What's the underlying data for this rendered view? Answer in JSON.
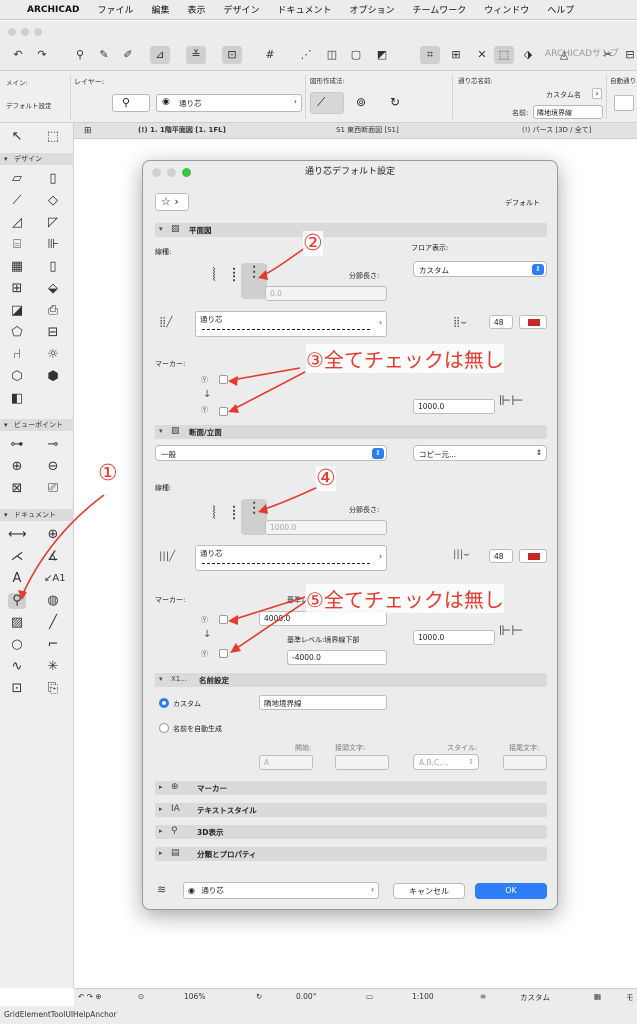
{
  "menubar": {
    "apple": "",
    "items": [
      "ARCHICAD",
      "ファイル",
      "編集",
      "表示",
      "デザイン",
      "ドキュメント",
      "オプション",
      "チームワーク",
      "ウィンドウ",
      "ヘルプ"
    ]
  },
  "toolbar": {
    "window_title": "ARCHICADサンプ"
  },
  "infobox": {
    "main_label": "メイン:",
    "main_value": "デフォルト設定",
    "layer_label": "レイヤー:",
    "layer_value": "通り芯",
    "method_label": "図形作成法:",
    "name_label": "通り芯名前:",
    "custom_name_label": "カスタム名",
    "name_field_label": "名前:",
    "name_value": "隣地境界線",
    "auto_label": "自動通り"
  },
  "tabs": [
    {
      "label": "(!) 1. 1階平面図 [1. 1FL]"
    },
    {
      "label": "S1 東西断面図 [S1]"
    },
    {
      "label": "(!) パース [3D / 全て]"
    }
  ],
  "toolbox": {
    "design": "デザイン",
    "viewpoint": "ビューポイント",
    "document": "ドキュメント"
  },
  "statusbar": {
    "zoom": "106%",
    "angle": "0.00°",
    "scale": "1:100",
    "custom": "カスタム",
    "more": "モ"
  },
  "anchor": "GridElementToolUIHelpAnchor",
  "dialog": {
    "title": "通り芯デフォルト設定",
    "preset": "デフォルト",
    "plan": {
      "title": "平面図",
      "linetype_label": "線種:",
      "floor_display_label": "フロア表示:",
      "floor_display_value": "カスタム",
      "segment_label": "分節長さ:",
      "segment_value": "0.0",
      "line_name": "通り芯",
      "pen_value": "48",
      "marker_label": "マーカー:",
      "extension_value": "1000.0"
    },
    "section": {
      "title": "断面/立面",
      "general_value": "一般",
      "copy_value": "コピー元...",
      "linetype_label": "線種:",
      "segment_label": "分節長さ:",
      "segment_value": "1000.0",
      "line_name": "通り芯",
      "pen_value": "48",
      "marker_label": "マーカー:",
      "ref_top_label": "基準レ",
      "ref_top_value": "4000.0",
      "ref_bottom_label": "基準レベル:境界線下部",
      "ref_bottom_value": "-4000.0",
      "extension_value": "1000.0"
    },
    "naming": {
      "title": "名前設定",
      "prefix_label": "X1...",
      "custom_label": "カスタム",
      "custom_value": "隣地境界線",
      "auto_label": "名前を自動生成",
      "start_label": "開始:",
      "start_value": "A",
      "prefix_text_label": "接頭文字:",
      "style_label": "スタイル:",
      "style_value": "A,B,C,...",
      "suffix_label": "接尾文字:"
    },
    "collapsed": [
      {
        "label": "マーカー"
      },
      {
        "label": "テキストスタイル"
      },
      {
        "label": "3D表示"
      },
      {
        "label": "分類とプロパティ"
      }
    ],
    "footer": {
      "layer_value": "通り芯",
      "cancel": "キャンセル",
      "ok": "OK"
    }
  },
  "annotations": {
    "a1": "①",
    "a2": "②",
    "a3": "③全てチェックは無し",
    "a4": "④",
    "a5": "⑤全てチェックは無し"
  },
  "colors": {
    "accent": "#2b7ef6",
    "annotation": "#e53a2e",
    "pen_red": "#c62828"
  }
}
